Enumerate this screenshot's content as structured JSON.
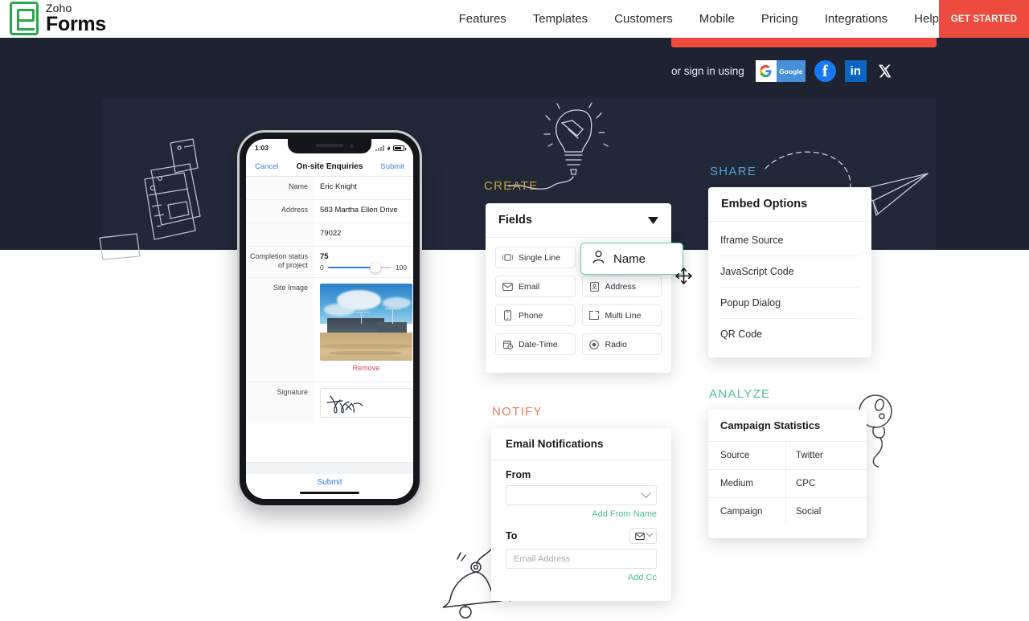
{
  "brand": {
    "top": "Zoho",
    "bottom": "Forms",
    "logo_color": "#2aa74b"
  },
  "nav": {
    "links": [
      {
        "label": "Features"
      },
      {
        "label": "Templates"
      },
      {
        "label": "Customers"
      },
      {
        "label": "Mobile"
      },
      {
        "label": "Pricing"
      },
      {
        "label": "Integrations"
      },
      {
        "label": "Help"
      }
    ],
    "cta": {
      "label": "GET STARTED",
      "color": "#ec4b3d"
    }
  },
  "signin": {
    "label": "or sign in using",
    "providers": [
      {
        "name": "google",
        "text": "Google"
      },
      {
        "name": "facebook",
        "text": "f"
      },
      {
        "name": "linkedin",
        "text": "in"
      },
      {
        "name": "x-twitter",
        "text": "𝕏"
      },
      {
        "name": "microsoft",
        "text": ""
      }
    ]
  },
  "hero": {
    "bg": "#1d2331",
    "panel_bg": "#212838"
  },
  "section_labels": {
    "create": "CREATE",
    "share": "SHARE",
    "notify": "NOTIFY",
    "analyze": "ANALYZE",
    "create_color": "#c9a23c",
    "share_color": "#5c9ed6",
    "notify_color": "#e0795a",
    "analyze_color": "#4bbf9b"
  },
  "phone": {
    "status": {
      "time": "1:03"
    },
    "formbar": {
      "cancel": "Cancel",
      "title": "On-site Enquiries",
      "submit": "Submit"
    },
    "rows": [
      {
        "label": "Name",
        "value": "Eric Knight"
      },
      {
        "label": "Address",
        "value": "583 Martha Ellen Drive"
      },
      {
        "label": "",
        "value": "79022"
      }
    ],
    "completion": {
      "label": "Completion status of project",
      "value": "75",
      "min": "0",
      "max": "100",
      "percent": 75
    },
    "site_image": {
      "label": "Site Image",
      "remove": "Remove"
    },
    "signature": {
      "label": "Signature"
    },
    "footer_submit": "Submit"
  },
  "fields_card": {
    "title": "Fields",
    "chips": [
      {
        "label": "Single Line",
        "icon": "single-line-icon"
      },
      {
        "label": "Email",
        "icon": "envelope-icon"
      },
      {
        "label": "Address",
        "icon": "address-card-icon"
      },
      {
        "label": "Phone",
        "icon": "phone-icon"
      },
      {
        "label": "Multi Line",
        "icon": "multi-line-icon"
      },
      {
        "label": "Date-Time",
        "icon": "calendar-clock-icon"
      },
      {
        "label": "Radio",
        "icon": "radio-button-icon"
      }
    ],
    "dragging": {
      "label": "Name",
      "icon": "user-icon",
      "border_color": "#5fcf9e"
    }
  },
  "embed_card": {
    "title": "Embed Options",
    "items": [
      {
        "label": "Iframe Source"
      },
      {
        "label": "JavaScript Code"
      },
      {
        "label": "Popup Dialog"
      },
      {
        "label": "QR Code"
      }
    ]
  },
  "stats_card": {
    "title": "Campaign Statistics",
    "rows": [
      {
        "key": "Source",
        "value": "Twitter"
      },
      {
        "key": "Medium",
        "value": "CPC"
      },
      {
        "key": "Campaign",
        "value": "Social"
      }
    ]
  },
  "notify_card": {
    "title": "Email Notifications",
    "from_label": "From",
    "from_value": "",
    "add_from_name": "Add From Name",
    "to_label": "To",
    "to_placeholder": "Email Address",
    "add_cc": "Add Cc",
    "link_color": "#4bbf9b"
  }
}
